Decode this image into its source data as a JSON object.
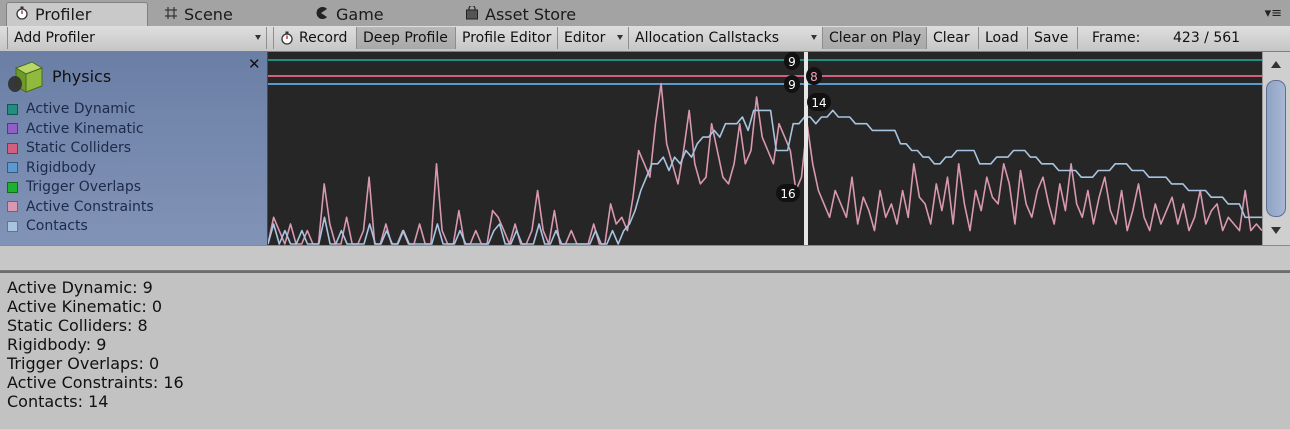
{
  "tabs": [
    {
      "label": "Profiler",
      "icon": "profiler-icon"
    },
    {
      "label": "Scene",
      "icon": "grid-icon"
    },
    {
      "label": "Game",
      "icon": "pacman-icon"
    },
    {
      "label": "Asset Store",
      "icon": "shop-bag-icon"
    }
  ],
  "toolbar": {
    "add_profiler": "Add Profiler",
    "record": "Record",
    "deep_profile": "Deep Profile",
    "profile_editor": "Profile Editor",
    "editor": "Editor",
    "allocation_callstacks": "Allocation Callstacks",
    "clear_on_play": "Clear on Play",
    "clear": "Clear",
    "load": "Load",
    "save": "Save",
    "frame_label": "Frame:",
    "frame_value": "423 / 561"
  },
  "module": {
    "title": "Physics",
    "legend": [
      {
        "label": "Active Dynamic",
        "color": "#1e8f80"
      },
      {
        "label": "Active Kinematic",
        "color": "#9060c8"
      },
      {
        "label": "Static Colliders",
        "color": "#d0607e"
      },
      {
        "label": "Rigidbody",
        "color": "#5a9ad0"
      },
      {
        "label": "Trigger Overlaps",
        "color": "#20b030"
      },
      {
        "label": "Active Constraints",
        "color": "#d898b0"
      },
      {
        "label": "Contacts",
        "color": "#a8c4e0"
      }
    ]
  },
  "chart_data": {
    "type": "line",
    "selected_frame": 423,
    "frame_count": 561,
    "value_labels": [
      {
        "series": "Active Dynamic",
        "value": "9",
        "color": "#1e8f80"
      },
      {
        "series": "Static Colliders",
        "value": "8",
        "color": "#d0607e"
      },
      {
        "series": "Rigidbody",
        "value": "9",
        "color": "#5a9ad0"
      },
      {
        "series": "Contacts",
        "value": "14",
        "color": "#a8c4e0"
      },
      {
        "series": "Active Constraints",
        "value": "16",
        "color": "#d898b0"
      }
    ],
    "series": [
      {
        "name": "Active Dynamic",
        "color": "#1e8f80",
        "values": [
          9
        ]
      },
      {
        "name": "Static Colliders",
        "color": "#d0607e",
        "values": [
          8
        ]
      },
      {
        "name": "Rigidbody",
        "color": "#5a9ad0",
        "values": [
          9
        ]
      },
      {
        "name": "Contacts",
        "color": "#a8c4e0",
        "values": [
          0,
          3,
          0,
          2,
          0,
          0,
          2,
          0,
          0,
          0,
          4,
          0,
          0,
          2,
          0,
          0,
          0,
          0,
          3,
          0,
          0,
          2,
          0,
          0,
          2,
          0,
          0,
          0,
          0,
          0,
          3,
          0,
          0,
          0,
          2,
          0,
          0,
          0,
          0,
          0,
          2,
          3,
          0,
          0,
          2,
          0,
          0,
          0,
          3,
          0,
          0,
          2,
          0,
          0,
          0,
          0,
          0,
          0,
          2,
          0,
          0,
          2,
          0,
          2,
          3,
          5,
          8,
          10,
          12,
          12,
          13,
          11,
          13,
          12,
          14,
          13,
          15,
          16,
          16,
          17,
          16,
          18,
          18,
          18,
          19,
          17,
          20,
          20,
          20,
          20,
          14,
          14,
          14,
          18,
          18,
          19,
          19,
          18,
          19,
          19,
          20,
          19,
          19,
          19,
          18,
          18,
          18,
          17,
          17,
          17,
          17,
          17,
          15,
          15,
          14,
          14,
          13,
          13,
          12,
          12,
          13,
          13,
          14,
          14,
          14,
          14,
          12,
          12,
          12,
          13,
          13,
          13,
          14,
          14,
          14,
          13,
          13,
          12,
          12,
          12,
          11,
          11,
          11,
          11,
          10,
          10,
          10,
          11,
          11,
          11,
          12,
          12,
          12,
          11,
          11,
          11,
          10,
          10,
          10,
          10,
          9,
          9,
          9,
          8,
          8,
          8,
          8,
          7,
          7,
          7,
          6,
          6,
          6,
          4,
          4,
          4,
          4
        ]
      },
      {
        "name": "Active Constraints",
        "color": "#d898b0",
        "values": [
          0,
          4,
          2,
          0,
          3,
          0,
          0,
          2,
          0,
          0,
          9,
          3,
          0,
          0,
          4,
          0,
          0,
          2,
          10,
          0,
          0,
          3,
          0,
          0,
          2,
          0,
          0,
          3,
          0,
          0,
          12,
          2,
          0,
          0,
          5,
          0,
          0,
          2,
          0,
          0,
          5,
          4,
          2,
          0,
          3,
          0,
          0,
          2,
          8,
          2,
          0,
          5,
          0,
          0,
          2,
          0,
          0,
          0,
          3,
          0,
          0,
          6,
          3,
          4,
          2,
          7,
          14,
          12,
          10,
          18,
          24,
          15,
          12,
          9,
          14,
          20,
          12,
          9,
          10,
          18,
          14,
          10,
          9,
          12,
          18,
          12,
          14,
          22,
          16,
          14,
          12,
          18,
          16,
          14,
          8,
          10,
          18,
          12,
          8,
          6,
          4,
          8,
          6,
          4,
          10,
          3,
          7,
          5,
          2,
          8,
          4,
          6,
          3,
          8,
          4,
          12,
          7,
          6,
          3,
          9,
          5,
          10,
          3,
          12,
          6,
          2,
          8,
          5,
          10,
          7,
          6,
          12,
          9,
          3,
          11,
          6,
          4,
          8,
          10,
          6,
          3,
          9,
          5,
          12,
          6,
          4,
          8,
          3,
          7,
          10,
          5,
          3,
          8,
          2,
          5,
          9,
          4,
          2,
          6,
          3,
          5,
          7,
          3,
          6,
          2,
          4,
          8,
          3,
          5,
          6,
          2,
          4,
          3,
          2,
          8,
          2,
          3,
          2
        ]
      }
    ]
  },
  "details": [
    "Active Dynamic: 9",
    "Active Kinematic: 0",
    "Static Colliders: 8",
    "Rigidbody: 9",
    "Trigger Overlaps: 0",
    "Active Constraints: 16",
    "Contacts: 14"
  ]
}
